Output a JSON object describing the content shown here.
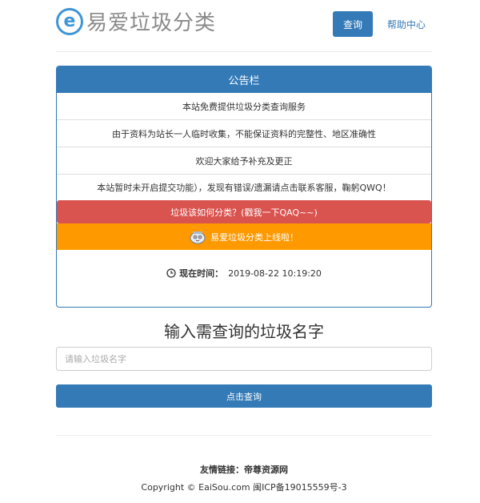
{
  "header": {
    "logo_letter": "e",
    "logo_text": "易爱垃圾分类",
    "nav_query": "查询",
    "nav_help": "帮助中心"
  },
  "notice": {
    "title": "公告栏",
    "items": [
      "本站免费提供垃圾分类查询服务",
      "由于资料为站长一人临时收集，不能保证资料的完整性、地区准确性",
      "欢迎大家给予补充及更正",
      "本站暂时未开启提交功能），发现有错误/遗漏请点击联系客服，鞠躬QWQ！"
    ],
    "how_button": "垃圾该如何分类？(戳我一下QAQ~~)",
    "launch_banner": "易爱垃圾分类上线啦！",
    "time_label": "现在时间：",
    "time_value": "2019-08-22 10:19:20"
  },
  "search": {
    "heading": "输入需查询的垃圾名字",
    "placeholder": "请输入垃圾名字",
    "button": "点击查询"
  },
  "footer": {
    "friends_label": "友情链接：",
    "friends_link": "帝尊资源网",
    "copyright_prefix": "Copyright © EaiSou.com 闽ICP备19015559号-3"
  },
  "colors": {
    "primary": "#337ab7",
    "danger": "#d9534f",
    "warning": "#ff9900"
  },
  "icons": {
    "logo": "e-circle-logo",
    "clock": "clock-icon",
    "mascot": "mascot-icon"
  }
}
